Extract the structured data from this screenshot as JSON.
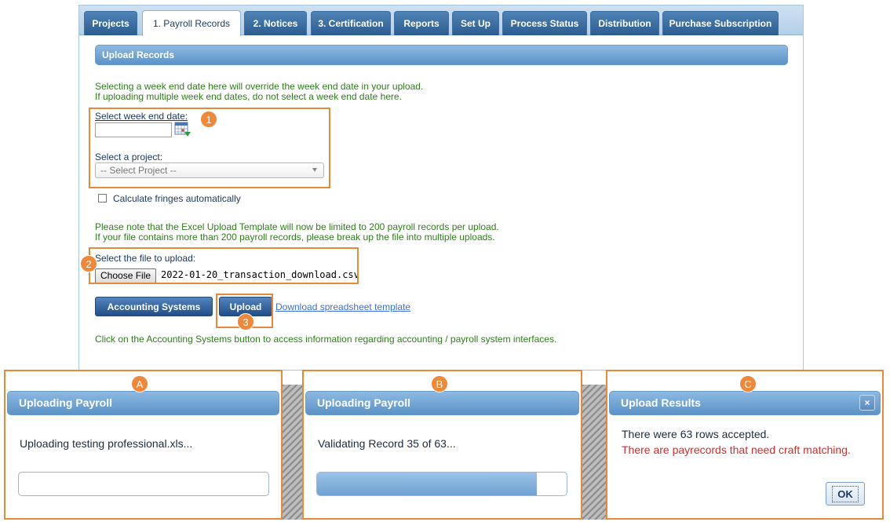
{
  "tabs": [
    {
      "label": "Projects",
      "active": false
    },
    {
      "label": "1. Payroll Records",
      "active": true
    },
    {
      "label": "2. Notices",
      "active": false
    },
    {
      "label": "3. Certification",
      "active": false
    },
    {
      "label": "Reports",
      "active": false
    },
    {
      "label": "Set Up",
      "active": false
    },
    {
      "label": "Process Status",
      "active": false
    },
    {
      "label": "Distribution",
      "active": false
    },
    {
      "label": "Purchase Subscription",
      "active": false
    }
  ],
  "upload": {
    "section_title": "Upload Records",
    "note_line1": "Selecting a week end date here will override the week end date in your upload.",
    "note_line2": "If uploading multiple week end dates, do not select a week end date here.",
    "week_label": "Select week end date:",
    "week_value": "",
    "project_label": "Select a project:",
    "project_placeholder": "-- Select Project --",
    "fringe_label": "Calculate fringes automatically",
    "fringe_checked": false,
    "limit_line1": "Please note that the Excel Upload Template will now be limited to 200 payroll records per upload.",
    "limit_line2": "If your file contains more than 200 payroll records, please break up the file into multiple uploads.",
    "file_label": "Select the file to upload:",
    "choose_label": "Choose File",
    "file_name": "2022-01-20_transaction_download.csv",
    "acct_button": "Accounting Systems",
    "upload_button": "Upload",
    "download_link": "Download spreadsheet template",
    "footer_note": "Click on the Accounting Systems button to access information regarding accounting / payroll system interfaces."
  },
  "callouts": {
    "one": "1",
    "two": "2",
    "three": "3",
    "a": "A",
    "b": "B",
    "c": "C"
  },
  "dialogs": {
    "a": {
      "title": "Uploading Payroll",
      "message": "Uploading testing professional.xls...",
      "progress": 0.0
    },
    "b": {
      "title": "Uploading Payroll",
      "message": "Validating Record 35 of 63...",
      "progress": 0.88
    },
    "c": {
      "title": "Upload Results",
      "line1": "There were 63 rows accepted.",
      "line2": "There are payrecords that need craft matching.",
      "ok_label": "OK",
      "close_label": "×"
    }
  },
  "colors": {
    "accent_orange": "#e8883a",
    "header_blue": "#5b93c6",
    "tab_blue": "#2c5c8f",
    "note_green": "#2e7d1a",
    "error_red": "#d12c2c"
  }
}
